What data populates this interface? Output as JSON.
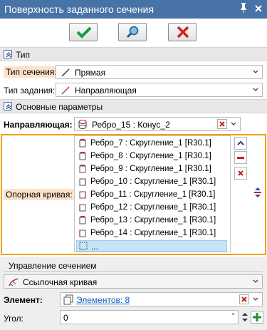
{
  "window": {
    "title": "Поверхность заданного сечения",
    "pin_icon": "pin-icon",
    "close_icon": "close-icon"
  },
  "toolbar": {
    "ok_icon": "check-icon",
    "preview_icon": "magnifier-icon",
    "cancel_icon": "cross-icon"
  },
  "section_type": {
    "label": "Тип"
  },
  "section_type_row": {
    "label": "Тип сечения:",
    "value": "Прямая"
  },
  "specify_type_row": {
    "label": "Тип задания:",
    "value": "Направляющая"
  },
  "main_params": {
    "label": "Основные параметры"
  },
  "guide": {
    "label": "Направляющая:",
    "value": "Ребро_15 : Конус_2"
  },
  "ref_curve": {
    "label": "Опорная кривая:",
    "items": [
      "Ребро_7 : Скругление_1 [R30.1]",
      "Ребро_8 : Скругление_1 [R30.1]",
      "Ребро_9 : Скругление_1 [R30.1]",
      "Ребро_10 : Скругление_1 [R30.1]",
      "Ребро_11 : Скругление_1 [R30.1]",
      "Ребро_12 : Скругление_1 [R30.1]",
      "Ребро_13 : Скругление_1 [R30.1]",
      "Ребро_14 : Скругление_1 [R30.1]"
    ],
    "new_item": "..."
  },
  "section_control": {
    "label": "Управление сечением",
    "value": "Ссылочная кривая"
  },
  "element": {
    "label": "Элемент:",
    "value": "Элементов: 8"
  },
  "angle": {
    "label": "Угол:",
    "value": "0",
    "unit": "°"
  },
  "colors": {
    "title_bar": "#4873a6",
    "highlight": "#f0a000",
    "label_bg": "#fde2c8",
    "link": "#0b60c0"
  }
}
